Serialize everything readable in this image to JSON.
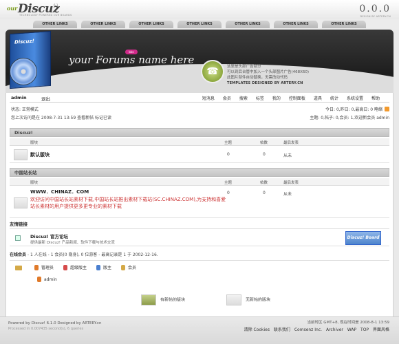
{
  "logo": {
    "prefix": "our",
    "name": "Discuz",
    "version": "6.1",
    "tagline": "TECHNOLOGY POWERED OUR BOARDS"
  },
  "brand_right": {
    "big": "0.0.0",
    "small": "DESIGN BY ARTERY.CN"
  },
  "nav_tabs": [
    "OTHER LINKS",
    "OTHER LINKS",
    "OTHER LINKS",
    "OTHER LINKS",
    "OTHER LINKS",
    "OTHER LINKS",
    "OTHER LINKS"
  ],
  "banner": {
    "box_text": "Discuz!",
    "your_forums": "your Forums name here",
    "badge": "bbs",
    "ad_lines": [
      "这里是头部广告部分",
      "可以到后台管中加入一个头部图片广告(468X60)",
      "此图片部件自动替换，无需改动代码"
    ],
    "designed_by": "TEMPLATES DESIGNED BY ARTERY.CN"
  },
  "userbar": {
    "username": "admin",
    "logout": "退出",
    "menu": [
      "短消息",
      "会员",
      "搜索",
      "标签",
      "我的",
      "控制面板",
      "道具",
      "统计",
      "系统设置",
      "帮助"
    ]
  },
  "stats": {
    "left1": "状态: 正常模式",
    "left2": "您上次访问是在 2008-7-31 13:59 查看新帖 标记已读",
    "right1": "今日: 0,昨日: 0,最高日: 0  略缩",
    "right2": "主题: 0,帖子: 0,会员: 1,欢迎新会员 admin"
  },
  "sections": [
    {
      "title": "Discuz!",
      "columns": [
        "版块",
        "主题",
        "帖数",
        "最后发表"
      ],
      "forums": [
        {
          "name": "默认版块",
          "topics": "0",
          "posts": "0",
          "last": "从未"
        }
      ]
    },
    {
      "title": "中国站长站",
      "columns": [
        "版块",
        "主题",
        "帖数",
        "最后发表"
      ],
      "forums": [
        {
          "name": "WWW．CHINAZ．COM",
          "topics": "0",
          "posts": "0",
          "last": "从未",
          "desc": "欢迎访问中国站长站素材下载,中国站长站推出素材下载站(SC.CHINAZ.COM),为支持和喜爱站长素材的用户提供更多更专业的素材下载"
        }
      ]
    }
  ],
  "friend_links": {
    "heading": "友情链接",
    "name": "Discuz! 官方论坛",
    "desc": "提供最新 Discuz! 产品新闻、软件下载与技术交流",
    "badge": "Discuz! Board"
  },
  "online": {
    "heading": "在线会员",
    "summary": " - 1 人在线 - 1 会员(0 隐身), 0 位游客 - 最高记录是 1 于 2002-12-16.",
    "legend": [
      {
        "label": "管理员",
        "color": "#e07a2a"
      },
      {
        "label": "超级版主",
        "color": "#d64b4b"
      },
      {
        "label": "版主",
        "color": "#4a7fcf"
      },
      {
        "label": "会员",
        "color": "#d4a947"
      }
    ],
    "user": "admin"
  },
  "post_legend": {
    "new": "有新帖的版块",
    "none": "无新帖的版块"
  },
  "footer": {
    "left1": "Powered by Discuz! 6.1.0 Designed by ARTERY.cn",
    "left2": "Processed in 0.007435 second(s), 6 queries",
    "right1": "当前时区 GMT+8, 现在时间是 2008-8-1 13:59",
    "links": [
      "清除 Cookies",
      "联系我们",
      "Comsenz Inc.",
      "Archiver",
      "WAP",
      "TOP",
      "界面风格"
    ]
  }
}
